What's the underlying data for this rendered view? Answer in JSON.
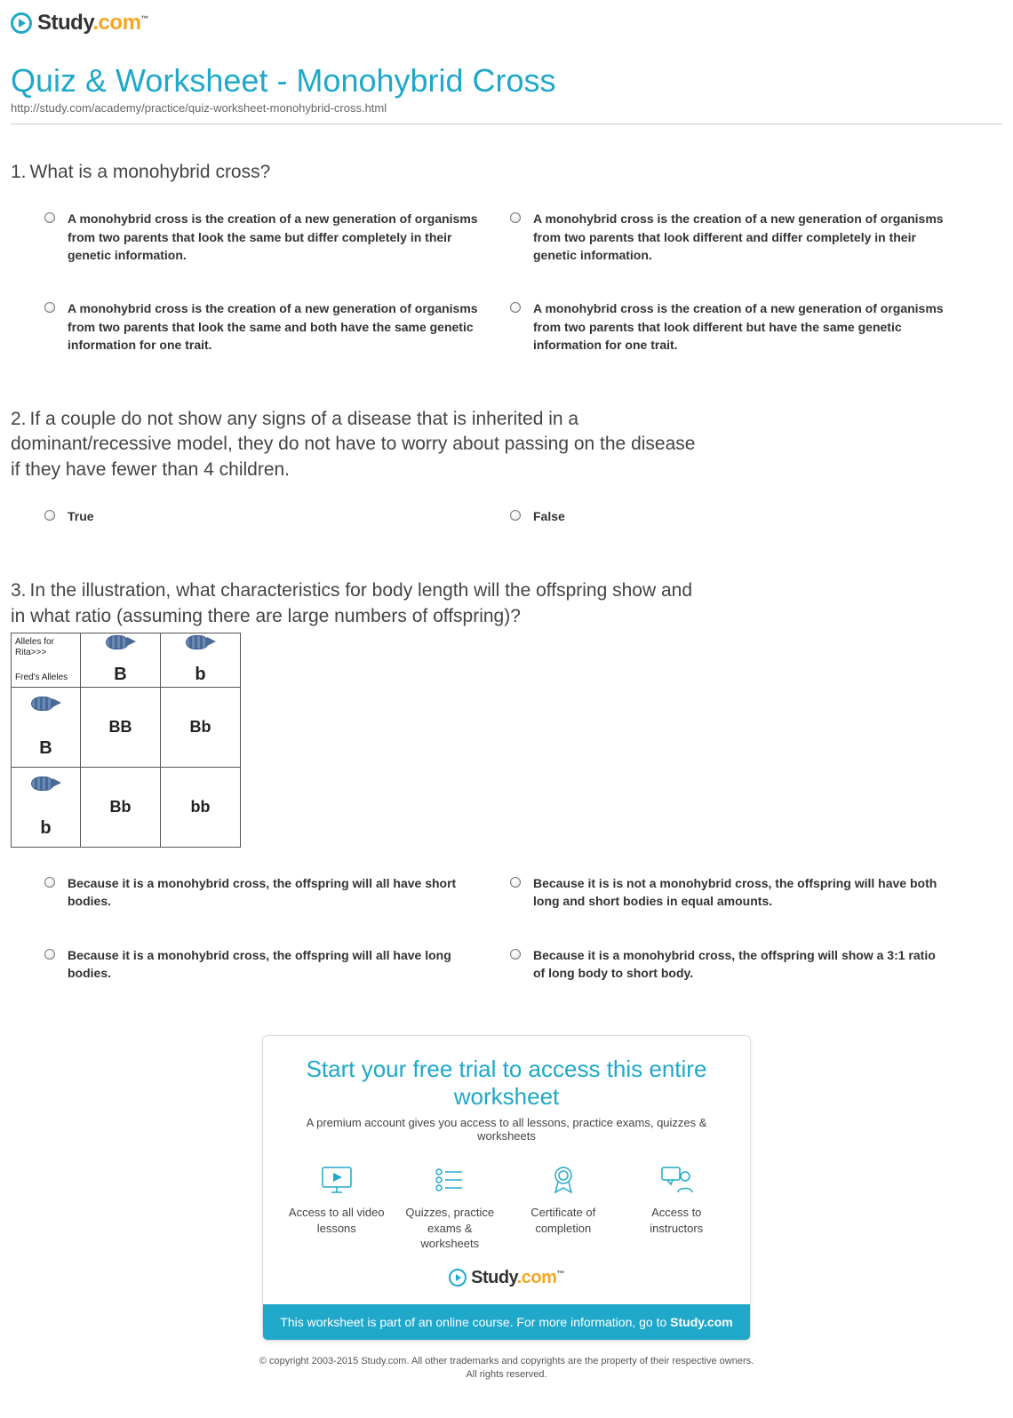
{
  "logo": {
    "brand": "Study",
    "suffix": ".com",
    "tm": "™"
  },
  "header": {
    "title": "Quiz & Worksheet - Monohybrid Cross",
    "url": "http://study.com/academy/practice/quiz-worksheet-monohybrid-cross.html"
  },
  "questions": [
    {
      "num": "1.",
      "text": "What is a monohybrid cross?",
      "options": [
        "A monohybrid cross is the creation of a new generation of organisms from two parents that look the same but differ completely in their genetic information.",
        "A monohybrid cross is the creation of a new generation of organisms from two parents that look different and differ completely in their genetic information.",
        "A monohybrid cross is the creation of a new generation of organisms from two parents that look the same and both have the same genetic information for one trait.",
        "A monohybrid cross is the creation of a new generation of organisms from two parents that look different but have the same genetic information for one trait."
      ]
    },
    {
      "num": "2.",
      "text": "If a couple do not show any signs of a disease that is inherited in a dominant/recessive model, they do not have to worry about passing on the disease if they have fewer than 4 children.",
      "options": [
        "True",
        "False"
      ]
    },
    {
      "num": "3.",
      "text": "In the illustration, what characteristics for body length will the offspring show and in what ratio (assuming there are large numbers of offspring)?",
      "options": [
        "Because it is a monohybrid cross, the offspring will all have short bodies.",
        "Because it is is not a monohybrid cross, the offspring will have both long and short bodies in equal amounts.",
        "Because it is a monohybrid cross, the offspring will all have long bodies.",
        "Because it is a monohybrid cross, the offspring will show a 3:1 ratio of long body to short body."
      ]
    }
  ],
  "punnett": {
    "corner_top": "Alleles for Rita>>>",
    "corner_bottom": "Fred's Alleles",
    "col_headers": [
      "B",
      "b"
    ],
    "row_headers": [
      "B",
      "b"
    ],
    "cells": [
      [
        "BB",
        "Bb"
      ],
      [
        "Bb",
        "bb"
      ]
    ]
  },
  "cta": {
    "title": "Start your free trial to access this entire worksheet",
    "subtitle": "A premium account gives you access to all lessons, practice exams, quizzes & worksheets",
    "features": [
      "Access to all video lessons",
      "Quizzes, practice exams & worksheets",
      "Certificate of completion",
      "Access to instructors"
    ],
    "bar_prefix": "This worksheet is part of an online course. For more information, go to ",
    "bar_link": "Study.com"
  },
  "copyright": {
    "line1": "© copyright 2003-2015 Study.com. All other trademarks and copyrights are the property of their respective owners.",
    "line2": "All rights reserved."
  }
}
